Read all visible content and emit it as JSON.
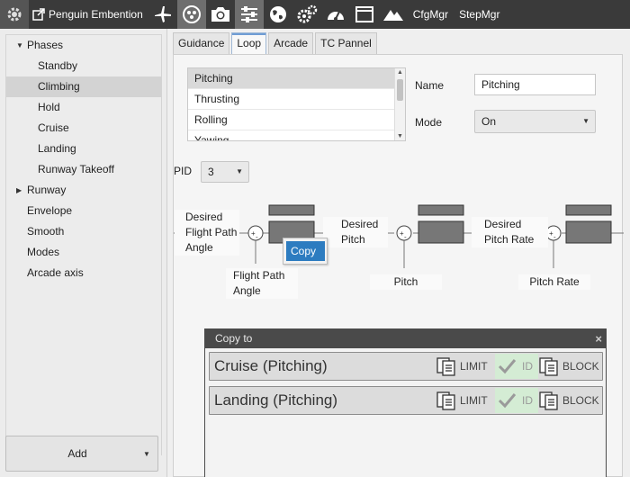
{
  "toolbar": {
    "title": "Penguin Embention",
    "cfgmgr": "CfgMgr",
    "stepmgr": "StepMgr",
    "icons": [
      "gear-icon",
      "external-link-icon",
      "plane-icon",
      "nodes-icon",
      "camera-icon",
      "sliders-icon",
      "globe-icon",
      "gears-icon",
      "gauge-icon",
      "window-icon",
      "mountain-icon"
    ]
  },
  "sidebar": {
    "tree": [
      {
        "label": "Phases"
      },
      {
        "label": "Standby"
      },
      {
        "label": "Climbing"
      },
      {
        "label": "Hold"
      },
      {
        "label": "Cruise"
      },
      {
        "label": "Landing"
      },
      {
        "label": "Runway Takeoff"
      },
      {
        "label": "Runway"
      },
      {
        "label": "Envelope"
      },
      {
        "label": "Smooth"
      },
      {
        "label": "Modes"
      },
      {
        "label": "Arcade axis"
      }
    ],
    "add_label": "Add"
  },
  "tabs": [
    {
      "label": "Guidance"
    },
    {
      "label": "Loop"
    },
    {
      "label": "Arcade"
    },
    {
      "label": "TC Pannel"
    }
  ],
  "loop": {
    "items": [
      "Pitching",
      "Thrusting",
      "Rolling",
      "Yawing"
    ],
    "name_label": "Name",
    "name_value": "Pitching",
    "mode_label": "Mode",
    "mode_value": "On",
    "pid_label": "PID",
    "pid_value": "3"
  },
  "diagram": {
    "desired_fpa": "Desired\nFlight Path\nAngle",
    "fpa": "Flight Path\nAngle",
    "desired_pitch": "Desired\nPitch",
    "pitch": "Pitch",
    "desired_pitch_rate": "Desired\nPitch Rate",
    "pitch_rate": "Pitch Rate"
  },
  "context_menu": {
    "copy": "Copy"
  },
  "copy_to": {
    "title": "Copy to",
    "close": "×",
    "rows": [
      {
        "title": "Cruise (Pitching)",
        "limit": "LIMIT",
        "id": "ID",
        "block": "BLOCK"
      },
      {
        "title": "Landing (Pitching)",
        "limit": "LIMIT",
        "id": "ID",
        "block": "BLOCK"
      }
    ]
  }
}
